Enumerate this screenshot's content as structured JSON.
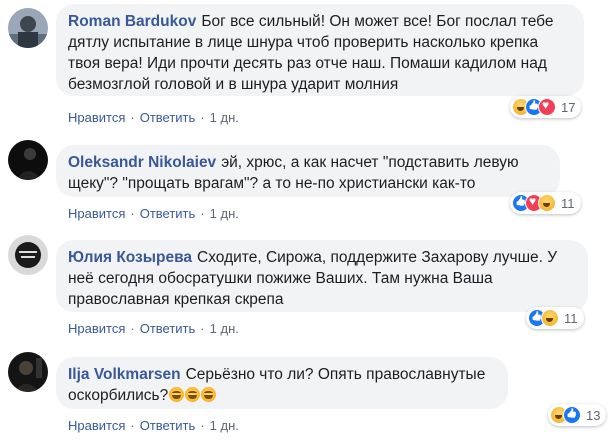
{
  "comments": [
    {
      "author": "Roman Bardukov",
      "text": "Бог все сильный! Он может все! Бог послал тебе дятлу испытание в лице шнура чтоб проверить насколько крепка твоя вера! Иди прочти десять раз отче наш. Помаши кадилом над безмозглой головой и в шнура ударит молния",
      "reaction_icons": [
        "haha-icon",
        "like-icon",
        "love-icon"
      ],
      "reaction_count": "17",
      "like_label": "Нравится",
      "reply_label": "Ответить",
      "time": "1 дн."
    },
    {
      "author": "Oleksandr Nikolaiev",
      "text": "эй, хрюс, а как насчет \"подставить левую щеку\"? \"прощать врагам\"? а то не-по христиански как-то",
      "reaction_icons": [
        "like-icon",
        "love-icon",
        "haha-icon"
      ],
      "reaction_count": "11",
      "like_label": "Нравится",
      "reply_label": "Ответить",
      "time": "1 дн."
    },
    {
      "author": "Юлия Козырева",
      "text": "Сходите, Сирожа, поддержите Захарову лучше. У неё сегодня обосратушки пожиже Ваших. Там нужна Ваша православная крепкая скрепа",
      "reaction_icons": [
        "like-icon",
        "haha-icon"
      ],
      "reaction_count": "11",
      "like_label": "Нравится",
      "reply_label": "Ответить",
      "time": "1 дн."
    },
    {
      "author": "Ilja Volkmarsen",
      "text": "Серьёзно что ли? Опять православнутые оскорбились?",
      "emoji_icons": [
        "rofl-emoji",
        "rofl-emoji",
        "rofl-emoji"
      ],
      "reaction_icons": [
        "haha-icon",
        "like-icon"
      ],
      "reaction_count": "13",
      "like_label": "Нравится",
      "reply_label": "Ответить",
      "time": "1 дн."
    }
  ],
  "separator": "·",
  "colors": {
    "author": "#385898",
    "bubble": "#f2f3f5",
    "like": "#1877f2",
    "love": "#f33e58",
    "haha": "#f7b125",
    "meta": "#606770"
  }
}
